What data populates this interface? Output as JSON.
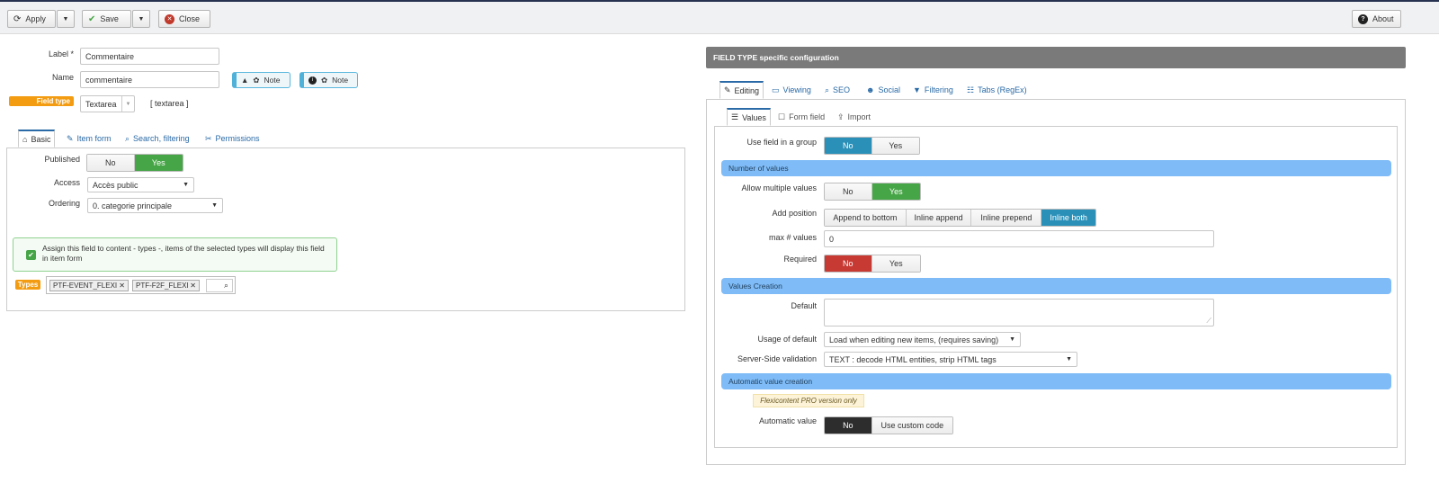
{
  "toolbar": {
    "apply_label": "Apply",
    "save_label": "Save",
    "close_label": "Close",
    "about_label": "About"
  },
  "left": {
    "label_label": "Label",
    "label_required": "*",
    "label_value": "Commentaire",
    "name_label": "Name",
    "name_value": "commentaire",
    "note1_label": "Note",
    "note2_label": "Note",
    "fieldtype_label": "Field type",
    "fieldtype_value": "Textarea",
    "fieldtype_code": "[ textarea ]",
    "tabs": [
      "Basic",
      "Item form",
      "Search, filtering",
      "Permissions"
    ],
    "published_label": "Published",
    "published_options": [
      "No",
      "Yes"
    ],
    "access_label": "Access",
    "access_value": "Accès public",
    "ordering_label": "Ordering",
    "ordering_value": "0. categorie principale",
    "assign_text": "Assign this field to content - types -, items of the selected types will display this field in item form",
    "types_label": "Types",
    "types": [
      "PTF-EVENT_FLEXI",
      "PTF-F2F_FLEXI"
    ]
  },
  "right": {
    "header": "FIELD TYPE specific configuration",
    "main_tabs": [
      "Editing",
      "Viewing",
      "SEO",
      "Social",
      "Filtering",
      "Tabs (RegEx)"
    ],
    "sub_tabs": [
      "Values",
      "Form field",
      "Import"
    ],
    "use_group_label": "Use field in a group",
    "use_group_options": [
      "No",
      "Yes"
    ],
    "section_number": "Number of values",
    "allow_multiple_label": "Allow multiple values",
    "allow_multiple_options": [
      "No",
      "Yes"
    ],
    "add_position_label": "Add position",
    "add_position_options": [
      "Append to bottom",
      "Inline append",
      "Inline prepend",
      "Inline both"
    ],
    "max_values_label": "max # values",
    "max_values_value": "0",
    "required_label": "Required",
    "required_options": [
      "No",
      "Yes"
    ],
    "section_creation": "Values Creation",
    "default_label": "Default",
    "usage_default_label": "Usage of default",
    "usage_default_value": "Load when editing new items, (requires saving)",
    "validation_label": "Server-Side validation",
    "validation_value": "TEXT : decode HTML entities, strip HTML tags",
    "section_auto": "Automatic value creation",
    "pro_note": "Flexicontent PRO version only",
    "auto_value_label": "Automatic value",
    "auto_value_options": [
      "No",
      "Use custom code"
    ]
  }
}
